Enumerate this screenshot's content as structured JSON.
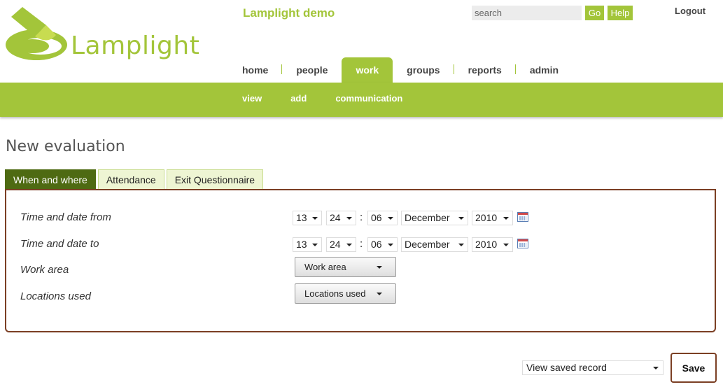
{
  "header": {
    "logo_text": "Lamplight",
    "app_title": "Lamplight demo",
    "search_placeholder": "search",
    "go_label": "Go",
    "help_label": "Help",
    "logout_label": "Logout"
  },
  "nav": {
    "items": [
      {
        "label": "home"
      },
      {
        "label": "people"
      },
      {
        "label": "work"
      },
      {
        "label": "groups"
      },
      {
        "label": "reports"
      },
      {
        "label": "admin"
      }
    ],
    "active": "work"
  },
  "subnav": {
    "items": [
      {
        "label": "view"
      },
      {
        "label": "add"
      },
      {
        "label": "communication"
      }
    ]
  },
  "page": {
    "heading": "New evaluation"
  },
  "tabs": [
    {
      "label": "When and where",
      "active": true
    },
    {
      "label": "Attendance",
      "active": false
    },
    {
      "label": "Exit Questionnaire",
      "active": false
    }
  ],
  "form": {
    "time_from": {
      "label": "Time and date from",
      "hour": "13",
      "minute": "24",
      "second": "06",
      "month": "December",
      "year": "2010"
    },
    "time_to": {
      "label": "Time and date to",
      "hour": "13",
      "minute": "24",
      "second": "06",
      "month": "December",
      "year": "2010"
    },
    "work_area": {
      "label": "Work area",
      "button": "Work area"
    },
    "locations": {
      "label": "Locations used",
      "button": "Locations used"
    },
    "colon": ":"
  },
  "footer": {
    "view_saved": "View saved record",
    "save_label": "Save"
  },
  "colors": {
    "brand_green": "#a3c53a",
    "active_tab": "#4e6a12",
    "panel_border": "#7b3f24"
  }
}
